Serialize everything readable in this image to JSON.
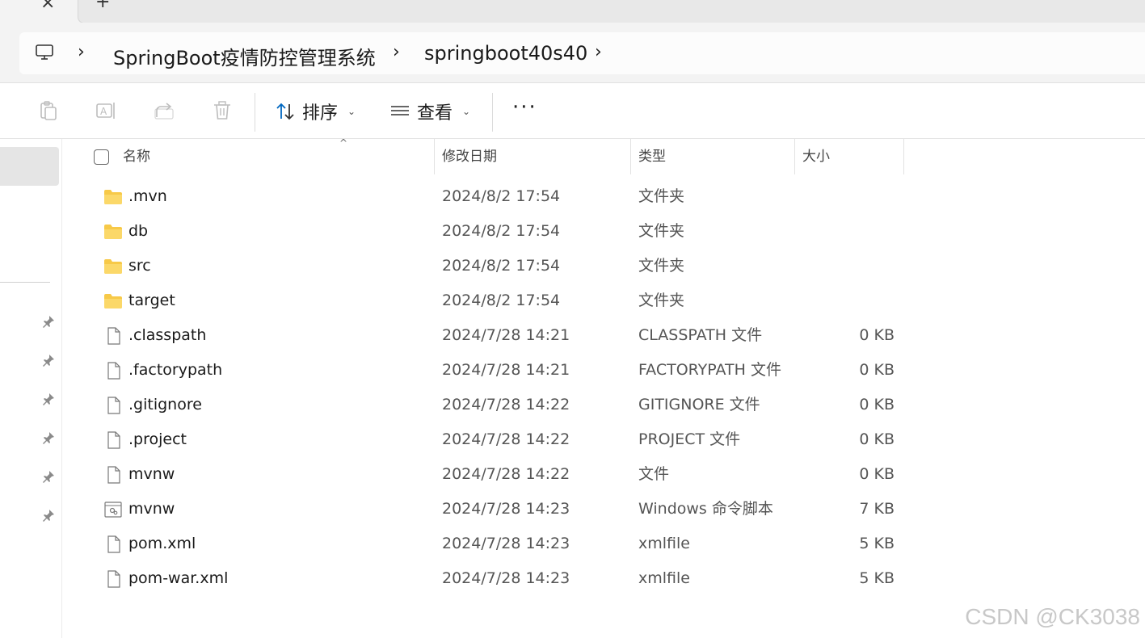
{
  "tabs": {
    "close_glyph": "×",
    "new_glyph": "+"
  },
  "address": {
    "crumbs": [
      "SpringBoot疫情防控管理系统",
      "springboot40s40"
    ],
    "separator": "›"
  },
  "toolbar": {
    "sort_label": "排序",
    "view_label": "查看",
    "more_label": "···",
    "caret": "⌄",
    "icons": [
      "clipboard-icon",
      "rename-icon",
      "share-icon",
      "delete-icon",
      "sort-icon",
      "view-icon"
    ]
  },
  "columns": {
    "name": "名称",
    "date": "修改日期",
    "type": "类型",
    "size": "大小"
  },
  "files": [
    {
      "name": ".mvn",
      "date": "2024/8/2 17:54",
      "type": "文件夹",
      "size": "",
      "icon": "folder-icon"
    },
    {
      "name": "db",
      "date": "2024/8/2 17:54",
      "type": "文件夹",
      "size": "",
      "icon": "folder-icon"
    },
    {
      "name": "src",
      "date": "2024/8/2 17:54",
      "type": "文件夹",
      "size": "",
      "icon": "folder-icon"
    },
    {
      "name": "target",
      "date": "2024/8/2 17:54",
      "type": "文件夹",
      "size": "",
      "icon": "folder-icon"
    },
    {
      "name": ".classpath",
      "date": "2024/7/28 14:21",
      "type": "CLASSPATH 文件",
      "size": "0 KB",
      "icon": "file-icon"
    },
    {
      "name": ".factorypath",
      "date": "2024/7/28 14:21",
      "type": "FACTORYPATH 文件",
      "size": "0 KB",
      "icon": "file-icon"
    },
    {
      "name": ".gitignore",
      "date": "2024/7/28 14:22",
      "type": "GITIGNORE 文件",
      "size": "0 KB",
      "icon": "file-icon"
    },
    {
      "name": ".project",
      "date": "2024/7/28 14:22",
      "type": "PROJECT 文件",
      "size": "0 KB",
      "icon": "file-icon"
    },
    {
      "name": "mvnw",
      "date": "2024/7/28 14:22",
      "type": "文件",
      "size": "0 KB",
      "icon": "file-icon"
    },
    {
      "name": "mvnw",
      "date": "2024/7/28 14:23",
      "type": "Windows 命令脚本",
      "size": "7 KB",
      "icon": "script-icon"
    },
    {
      "name": "pom.xml",
      "date": "2024/7/28 14:23",
      "type": "xmlfile",
      "size": "5 KB",
      "icon": "file-icon"
    },
    {
      "name": "pom-war.xml",
      "date": "2024/7/28 14:23",
      "type": "xmlfile",
      "size": "5 KB",
      "icon": "file-icon"
    }
  ],
  "watermark": "CSDN @CK3038",
  "colors": {
    "accent": "#0067c0",
    "folder": "#f7c948",
    "selected": "#e5e5e5"
  }
}
